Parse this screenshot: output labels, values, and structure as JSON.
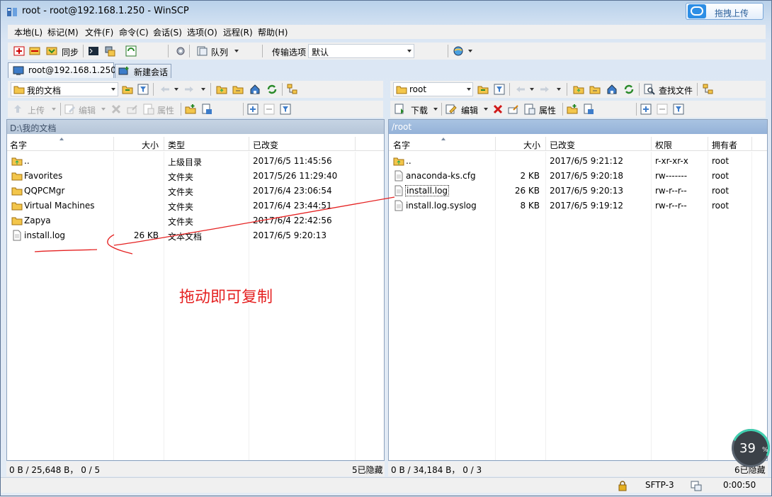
{
  "window": {
    "title": "root - root@192.168.1.250 - WinSCP",
    "upload_label": "拖拽上传"
  },
  "menu": [
    "本地(L)",
    "标记(M)",
    "文件(F)",
    "命令(C)",
    "会话(S)",
    "选项(O)",
    "远程(R)",
    "帮助(H)"
  ],
  "toolbar": {
    "sync_label": "同步",
    "queue_label": "队列",
    "transfer_label": "传输选项",
    "transfer_value": "默认"
  },
  "tabs": [
    {
      "label": "root@192.168.1.250"
    },
    {
      "label": "新建会话"
    }
  ],
  "left": {
    "location": "我的文档",
    "upload_label": "上传",
    "edit_label": "编辑",
    "props_label": "属性",
    "path": "D:\\我的文档",
    "columns": [
      "名字",
      "大小",
      "类型",
      "已改变"
    ],
    "rows": [
      {
        "name": "..",
        "size": "",
        "type": "上级目录",
        "date": "2017/6/5  11:45:56",
        "icon": "parent-folder-icon"
      },
      {
        "name": "Favorites",
        "size": "",
        "type": "文件夹",
        "date": "2017/5/26  11:29:40",
        "icon": "folder-icon"
      },
      {
        "name": "QQPCMgr",
        "size": "",
        "type": "文件夹",
        "date": "2017/6/4  23:06:54",
        "icon": "folder-icon"
      },
      {
        "name": "Virtual Machines",
        "size": "",
        "type": "文件夹",
        "date": "2017/6/4  23:44:51",
        "icon": "folder-icon"
      },
      {
        "name": "Zapya",
        "size": "",
        "type": "文件夹",
        "date": "2017/6/4  22:42:56",
        "icon": "folder-icon"
      },
      {
        "name": "install.log",
        "size": "26 KB",
        "type": "文本文档",
        "date": "2017/6/5  9:20:13",
        "icon": "file-icon"
      }
    ],
    "status_left": "0 B / 25,648 B，  0 / 5",
    "status_right": "5已隐藏"
  },
  "right": {
    "location": "root",
    "find_label": "查找文件",
    "download_label": "下载",
    "edit_label": "编辑",
    "props_label": "属性",
    "path": "/root",
    "columns": [
      "名字",
      "大小",
      "已改变",
      "权限",
      "拥有者"
    ],
    "rows": [
      {
        "name": "..",
        "size": "",
        "date": "2017/6/5 9:21:12",
        "perm": "r-xr-xr-x",
        "owner": "root",
        "icon": "parent-folder-icon"
      },
      {
        "name": "anaconda-ks.cfg",
        "size": "2 KB",
        "date": "2017/6/5 9:20:18",
        "perm": "rw-------",
        "owner": "root",
        "icon": "file-icon"
      },
      {
        "name": "install.log",
        "size": "26 KB",
        "date": "2017/6/5 9:20:13",
        "perm": "rw-r--r--",
        "owner": "root",
        "icon": "file-icon"
      },
      {
        "name": "install.log.syslog",
        "size": "8 KB",
        "date": "2017/6/5 9:19:12",
        "perm": "rw-r--r--",
        "owner": "root",
        "icon": "file-icon"
      }
    ],
    "status_left": "0 B / 34,184 B，  0 / 3",
    "status_right": "6已隐藏"
  },
  "annotation": "拖动即可复制",
  "bottom": {
    "protocol": "SFTP-3",
    "time": "0:00:50"
  },
  "progress": {
    "value": "39",
    "unit": "%"
  },
  "colors": {
    "annotation": "#e52222",
    "accent": "#2d8ee5"
  }
}
